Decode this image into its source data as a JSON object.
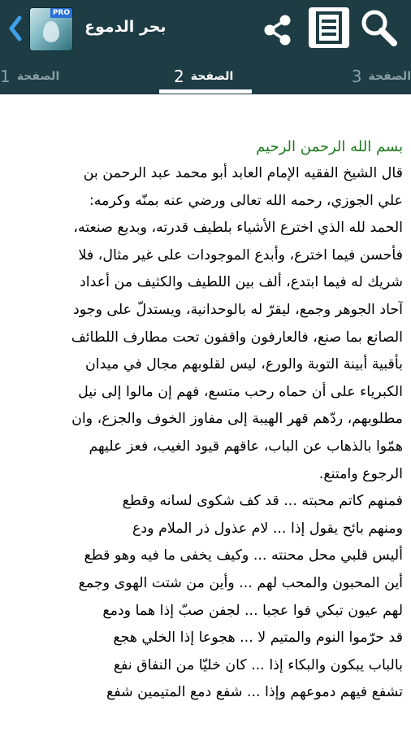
{
  "appbar": {
    "title": "بحر الدموع",
    "logo_badge": "PRO",
    "icons": [
      "back-chevron-icon",
      "app-logo",
      "share-icon",
      "menu-list-icon",
      "search-icon"
    ]
  },
  "tabs": {
    "left": {
      "label": "الصفحة",
      "number": "1"
    },
    "center": {
      "label": "الصفحة",
      "number": "2"
    },
    "right": {
      "label": "الصفحة",
      "number": "3"
    },
    "selected": "center"
  },
  "colors": {
    "appbar": "#1d3c44",
    "heading_green": "#1e7a1e",
    "text": "#000000",
    "tab_inactive": "#8aa0a6"
  },
  "content": {
    "heading": "بسم الله الرحمن الرحيم",
    "lines": [
      "قال الشيخ الفقيه الإمام العابد أبو محمد عبد الرحمن بن",
      "علي الجوزي، رحمه الله تعالى ورضي عنه بمنّه وكرمه:",
      "الحمد لله الذي اخترع الأشياء بلطيف قدرته، وبديع صنعته،",
      "فأحسن فيما اخترع، وأبدع الموجودات على غير مثال، فلا",
      "شريك له فيما ابتدع، ألف بين اللطيف والكثيف من أعداد",
      "آحاد الجوهر وجمع، ليقرّ له بالوحدانية، ويستدلّ على وجود",
      "الصانع بما صنع، فالعارفون واقفون تحت مطارف اللطائف",
      "بأقبية أبينة التوبة والورع، ليس لقلوبهم مجال في ميدان",
      "الكبرياء على أن حماه رحب متسع، فهم إن مالوا إلى نيل",
      "مطلوبهم، ردّهم قهر الهيبة إلى مفاوز الخوف والجزع، وان",
      "همّوا بالذهاب عن الباب، عاقهم قيود الغيب، فعز عليهم",
      "الرجوع وامتنع.",
      "فمنهم كاتم محبته ... قد كف شكوى لسانه وقطع",
      "ومنهم بائح يقول إذا ... لام عذول ذر الملام ودع",
      "أليس قلبي محل محنته ... وكيف يخفى ما فيه وهو قطع",
      "أين المحبون والمحب لهم ... وأين من شتت الهوى وجمع",
      "لهم عيون تبكي فوا عجبا ... لجفن صبّ إذا هما ودمع",
      "قد حرّموا النوم والمتيم لا ... هجوعا إذا الخلي هجع",
      "بالباب يبكون والبكاء إذا ... كان خليّا من النفاق نفع",
      "تشفع فيهم دموعهم وإذا ... شفع دمع المتيمين شفع"
    ]
  }
}
